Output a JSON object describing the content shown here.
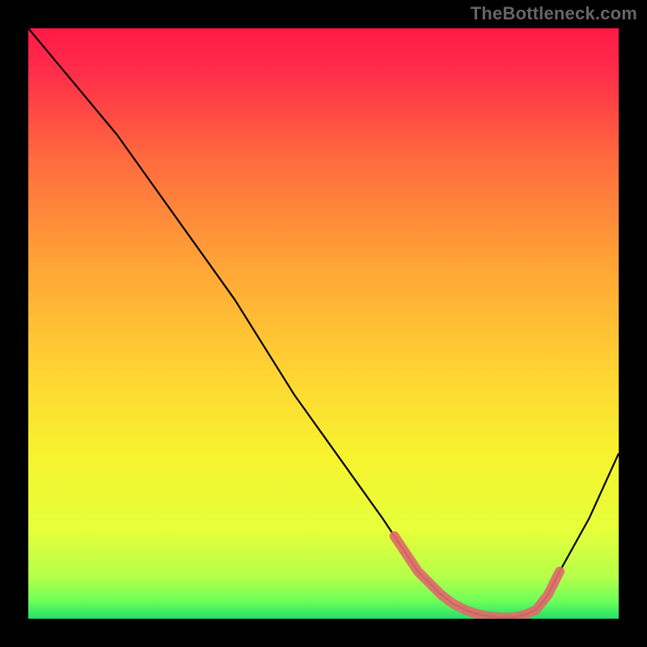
{
  "watermark": "TheBottleneck.com",
  "chart_data": {
    "type": "line",
    "title": "",
    "xlabel": "",
    "ylabel": "",
    "xlim": [
      0,
      100
    ],
    "ylim": [
      0,
      100
    ],
    "series": [
      {
        "name": "curve",
        "x": [
          0,
          5,
          10,
          15,
          20,
          25,
          30,
          35,
          40,
          45,
          50,
          55,
          60,
          62,
          64,
          66,
          68,
          70,
          72,
          74,
          76,
          78,
          80,
          82,
          84,
          86,
          88,
          90,
          95,
          100
        ],
        "y": [
          100,
          94,
          88,
          82,
          75,
          68,
          61,
          54,
          46,
          38,
          31,
          24,
          17,
          14,
          11,
          8,
          6,
          4,
          2.5,
          1.5,
          0.8,
          0.4,
          0.2,
          0.2,
          0.6,
          1.5,
          4,
          8,
          17,
          28
        ]
      },
      {
        "name": "highlight-band",
        "x": [
          62,
          64,
          66,
          68,
          70,
          72,
          74,
          76,
          78,
          80,
          82,
          84,
          86,
          88,
          90
        ],
        "y": [
          14,
          11,
          8,
          6,
          4,
          2.5,
          1.5,
          0.8,
          0.4,
          0.2,
          0.2,
          0.6,
          1.5,
          4,
          8
        ]
      }
    ],
    "gradient_stops": [
      {
        "pct": 0,
        "color": "#ff1a47"
      },
      {
        "pct": 8,
        "color": "#ff2f4a"
      },
      {
        "pct": 22,
        "color": "#ff6a3e"
      },
      {
        "pct": 40,
        "color": "#ffa436"
      },
      {
        "pct": 58,
        "color": "#ffd333"
      },
      {
        "pct": 72,
        "color": "#f7f22e"
      },
      {
        "pct": 85,
        "color": "#e6ff3a"
      },
      {
        "pct": 93,
        "color": "#b4ff4a"
      },
      {
        "pct": 97,
        "color": "#6eff5a"
      },
      {
        "pct": 100,
        "color": "#23e06a"
      }
    ],
    "grid": false,
    "legend": null,
    "annotations": []
  }
}
